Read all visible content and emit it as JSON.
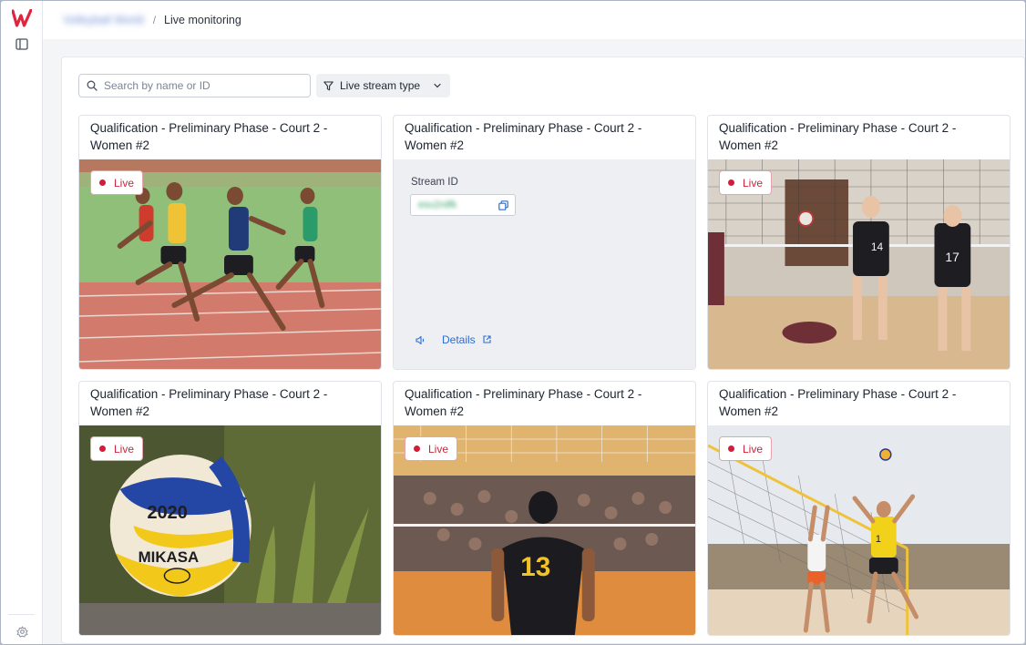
{
  "nav": {
    "logo": "w-logo-icon",
    "panel_icon": "sidebar-toggle-icon",
    "settings_icon": "gear-icon"
  },
  "breadcrumb": {
    "parent": "Volleyball World",
    "separator": "/",
    "current": "Live monitoring"
  },
  "toolbar": {
    "search_placeholder": "Search by name or ID",
    "search_value": "",
    "filter_label": "Live stream type"
  },
  "cards": [
    {
      "title": "Qualification - Preliminary Phase - Court 2 - Women #2",
      "badge": "Live",
      "scene": "track-race-photo"
    },
    {
      "title": "Qualification - Preliminary Phase - Court 2 - Women #2",
      "stream_id_label": "Stream ID",
      "stream_id_value": "esu2rdfk",
      "details_label": "Details"
    },
    {
      "title": "Qualification - Preliminary Phase - Court 2 - Women #2",
      "badge": "Live",
      "scene": "indoor-volleyball-block-photo"
    },
    {
      "title": "Qualification - Preliminary Phase - Court 2 - Women #2",
      "badge": "Live",
      "scene": "volleyball-ball-photo",
      "ball_text": "2020 MIKASA"
    },
    {
      "title": "Qualification - Preliminary Phase - Court 2 - Women #2",
      "badge": "Live",
      "scene": "indoor-volleyball-player-13-photo",
      "jersey_number": "13"
    },
    {
      "title": "Qualification - Preliminary Phase - Court 2 - Women #2",
      "badge": "Live",
      "scene": "beach-volleyball-photo"
    }
  ],
  "colors": {
    "live_red": "#d21d3a",
    "link_blue": "#2d6dd2",
    "brand_red": "#e0253f"
  }
}
